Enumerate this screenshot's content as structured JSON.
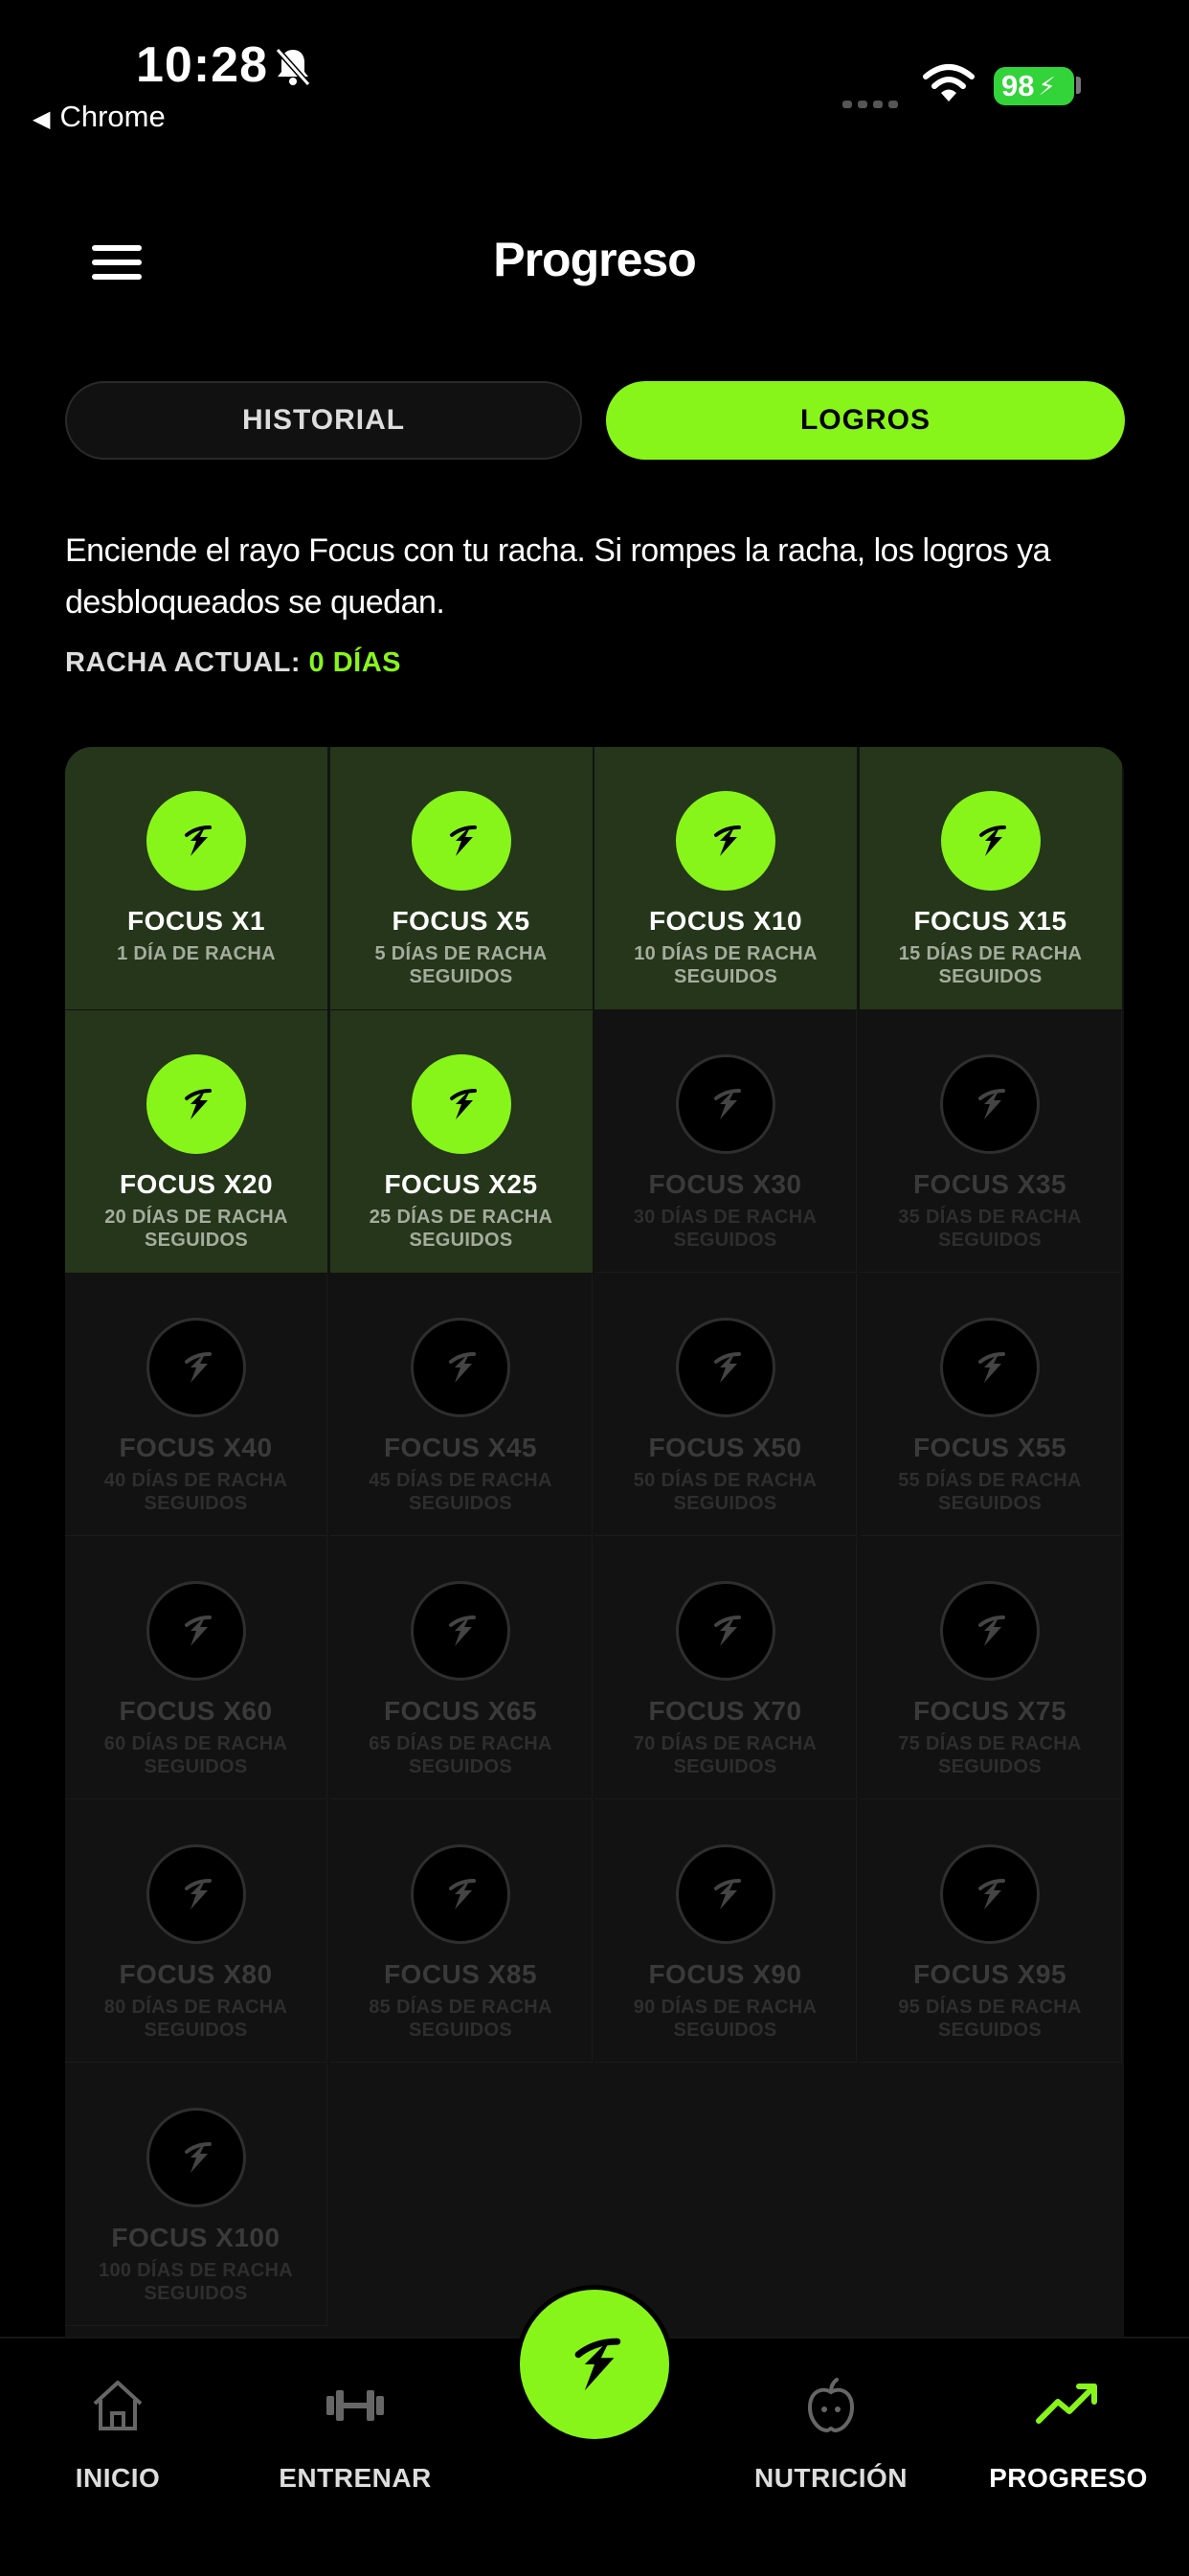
{
  "status_bar": {
    "time": "10:28",
    "back_label": "Chrome",
    "battery": "98"
  },
  "header": {
    "title": "Progreso"
  },
  "tabs": [
    {
      "label": "HISTORIAL",
      "active": false
    },
    {
      "label": "LOGROS",
      "active": true
    }
  ],
  "intro": "Enciende el rayo Focus con tu racha. Si rompes la racha, los logros ya desbloqueados se quedan.",
  "streak": {
    "label": "RACHA ACTUAL:",
    "value": "0 DÍAS"
  },
  "colors": {
    "accent": "#88f51a",
    "unlocked_bg": "#25361a",
    "background": "#000000"
  },
  "achievements": [
    {
      "title": "FOCUS X1",
      "subtitle": "1 DÍA DE RACHA",
      "unlocked": true
    },
    {
      "title": "FOCUS X5",
      "subtitle": "5 DÍAS DE RACHA SEGUIDOS",
      "unlocked": true
    },
    {
      "title": "FOCUS X10",
      "subtitle": "10 DÍAS DE RACHA SEGUIDOS",
      "unlocked": true
    },
    {
      "title": "FOCUS X15",
      "subtitle": "15 DÍAS DE RACHA SEGUIDOS",
      "unlocked": true
    },
    {
      "title": "FOCUS X20",
      "subtitle": "20 DÍAS DE RACHA SEGUIDOS",
      "unlocked": true
    },
    {
      "title": "FOCUS X25",
      "subtitle": "25 DÍAS DE RACHA SEGUIDOS",
      "unlocked": true
    },
    {
      "title": "FOCUS X30",
      "subtitle": "30 DÍAS DE RACHA SEGUIDOS",
      "unlocked": false
    },
    {
      "title": "FOCUS X35",
      "subtitle": "35 DÍAS DE RACHA SEGUIDOS",
      "unlocked": false
    },
    {
      "title": "FOCUS X40",
      "subtitle": "40 DÍAS DE RACHA SEGUIDOS",
      "unlocked": false
    },
    {
      "title": "FOCUS X45",
      "subtitle": "45 DÍAS DE RACHA SEGUIDOS",
      "unlocked": false
    },
    {
      "title": "FOCUS X50",
      "subtitle": "50 DÍAS DE RACHA SEGUIDOS",
      "unlocked": false
    },
    {
      "title": "FOCUS X55",
      "subtitle": "55 DÍAS DE RACHA SEGUIDOS",
      "unlocked": false
    },
    {
      "title": "FOCUS X60",
      "subtitle": "60 DÍAS DE RACHA SEGUIDOS",
      "unlocked": false
    },
    {
      "title": "FOCUS X65",
      "subtitle": "65 DÍAS DE RACHA SEGUIDOS",
      "unlocked": false
    },
    {
      "title": "FOCUS X70",
      "subtitle": "70 DÍAS DE RACHA SEGUIDOS",
      "unlocked": false
    },
    {
      "title": "FOCUS X75",
      "subtitle": "75 DÍAS DE RACHA SEGUIDOS",
      "unlocked": false
    },
    {
      "title": "FOCUS X80",
      "subtitle": "80 DÍAS DE RACHA SEGUIDOS",
      "unlocked": false
    },
    {
      "title": "FOCUS X85",
      "subtitle": "85 DÍAS DE RACHA SEGUIDOS",
      "unlocked": false
    },
    {
      "title": "FOCUS X90",
      "subtitle": "90 DÍAS DE RACHA SEGUIDOS",
      "unlocked": false
    },
    {
      "title": "FOCUS X95",
      "subtitle": "95 DÍAS DE RACHA SEGUIDOS",
      "unlocked": false
    },
    {
      "title": "FOCUS X100",
      "subtitle": "100 DÍAS DE RACHA SEGUIDOS",
      "unlocked": false
    }
  ],
  "nav": [
    {
      "label": "INICIO",
      "icon": "home-icon"
    },
    {
      "label": "ENTRENAR",
      "icon": "dumbbell-icon"
    },
    {
      "label": "NUTRICIÓN",
      "icon": "apple-icon"
    },
    {
      "label": "PROGRESO",
      "icon": "trending-up-icon",
      "active": true
    }
  ]
}
